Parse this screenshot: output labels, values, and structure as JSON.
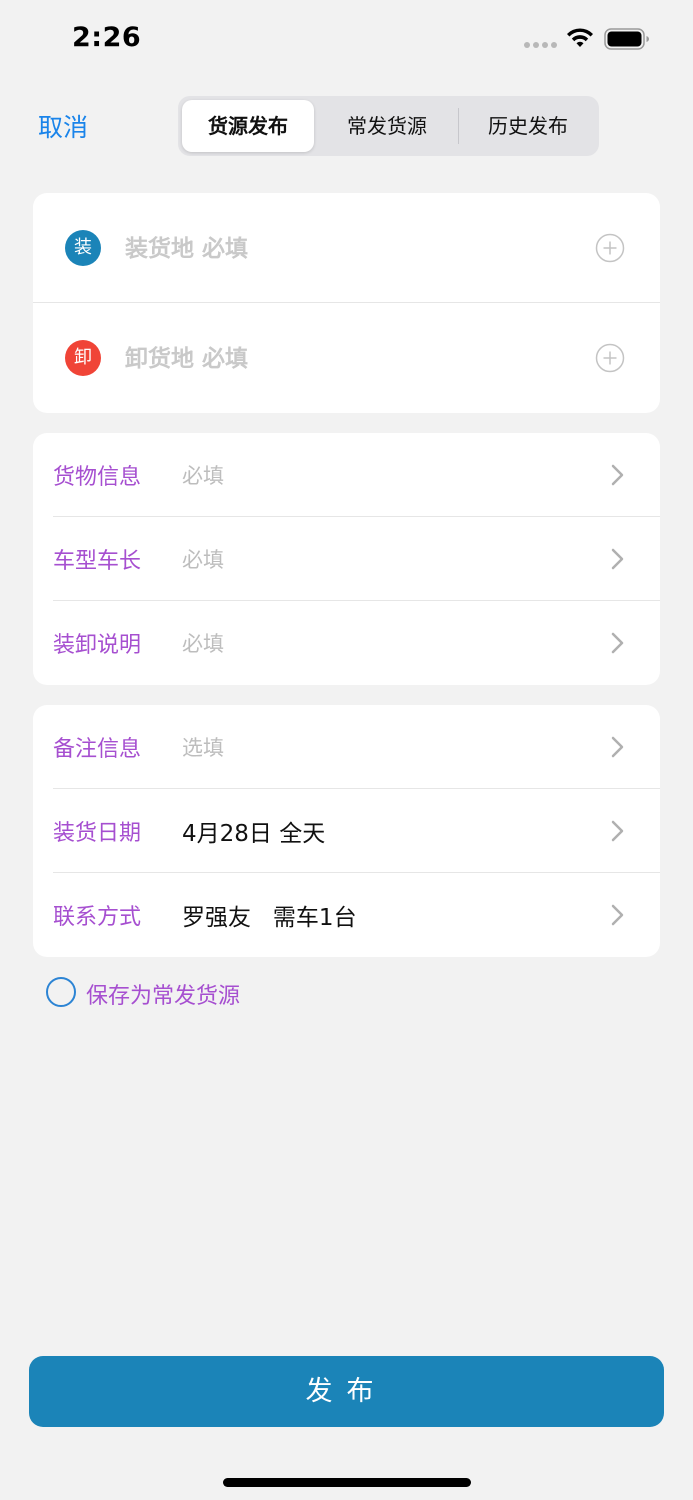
{
  "status_bar": {
    "time": "2:26"
  },
  "header": {
    "cancel_label": "取消",
    "tabs": [
      {
        "label": "货源发布",
        "active": true
      },
      {
        "label": "常发货源",
        "active": false
      },
      {
        "label": "历史发布",
        "active": false
      }
    ]
  },
  "locations": {
    "load": {
      "badge": "装",
      "placeholder": "装货地 必填",
      "badge_color": "#1b84b8"
    },
    "unload": {
      "badge": "卸",
      "placeholder": "卸货地 必填",
      "badge_color": "#f04437"
    }
  },
  "cargo_section": {
    "rows": [
      {
        "label": "货物信息",
        "value": "必填"
      },
      {
        "label": "车型车长",
        "value": "必填"
      },
      {
        "label": "装卸说明",
        "value": "必填"
      }
    ]
  },
  "extra_section": {
    "rows": [
      {
        "label": "备注信息",
        "value": "选填"
      },
      {
        "label": "装货日期",
        "value": "4月28日 全天"
      },
      {
        "label": "联系方式",
        "value": "罗强友   需车1台"
      }
    ]
  },
  "save_option": {
    "label": "保存为常发货源"
  },
  "publish_button": {
    "label": "发布"
  },
  "colors": {
    "accent_blue": "#1a84ea",
    "label_purple": "#a64fd0",
    "button_blue": "#1b84b8",
    "placeholder_gray": "#bdbdbd"
  }
}
